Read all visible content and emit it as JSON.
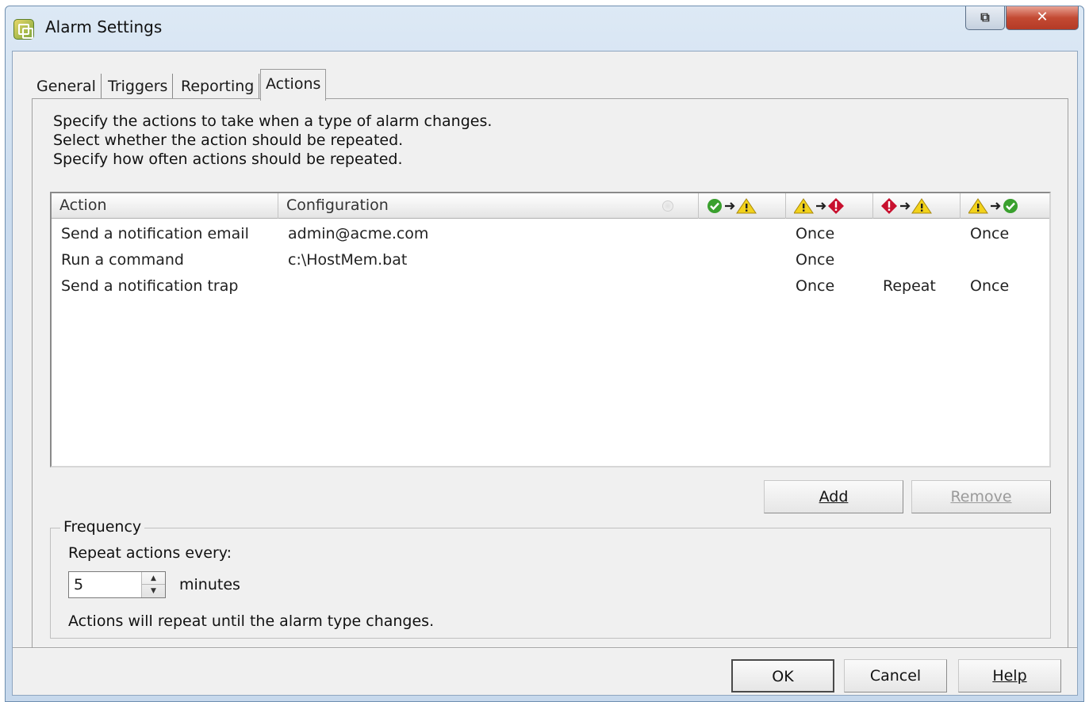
{
  "window": {
    "title": "Alarm Settings"
  },
  "tabs": [
    {
      "label": "General"
    },
    {
      "label": "Triggers"
    },
    {
      "label": "Reporting"
    },
    {
      "label": "Actions",
      "active": true
    }
  ],
  "description": [
    "Specify the actions to take when a type of alarm changes.",
    "Select whether the action should be repeated.",
    "Specify how often actions should be repeated."
  ],
  "grid": {
    "columns": [
      {
        "label": "Action"
      },
      {
        "label": "Configuration"
      },
      {
        "icon": "ok-to-warning-icon"
      },
      {
        "icon": "warning-to-alert-icon"
      },
      {
        "icon": "alert-to-warning-icon"
      },
      {
        "icon": "warning-to-ok-icon"
      }
    ],
    "rows": [
      {
        "action": "Send a notification email",
        "config": "admin@acme.com",
        "ok_warn": "",
        "warn_alert": "Once",
        "alert_warn": "",
        "warn_ok": "Once"
      },
      {
        "action": "Run a command",
        "config": "c:\\HostMem.bat",
        "ok_warn": "",
        "warn_alert": "Once",
        "alert_warn": "",
        "warn_ok": ""
      },
      {
        "action": "Send a notification trap",
        "config": "",
        "ok_warn": "",
        "warn_alert": "Once",
        "alert_warn": "Repeat",
        "warn_ok": "Once"
      }
    ]
  },
  "buttons": {
    "add": "Add",
    "remove": "Remove",
    "ok": "OK",
    "cancel": "Cancel",
    "help": "Help"
  },
  "frequency": {
    "legend": "Frequency",
    "label": "Repeat actions every:",
    "value": "5",
    "unit": "minutes",
    "note": "Actions will repeat until the alarm type changes."
  },
  "colors": {
    "ok": "#3aa02e",
    "warning": "#f2d21b",
    "alert": "#c8102e"
  }
}
